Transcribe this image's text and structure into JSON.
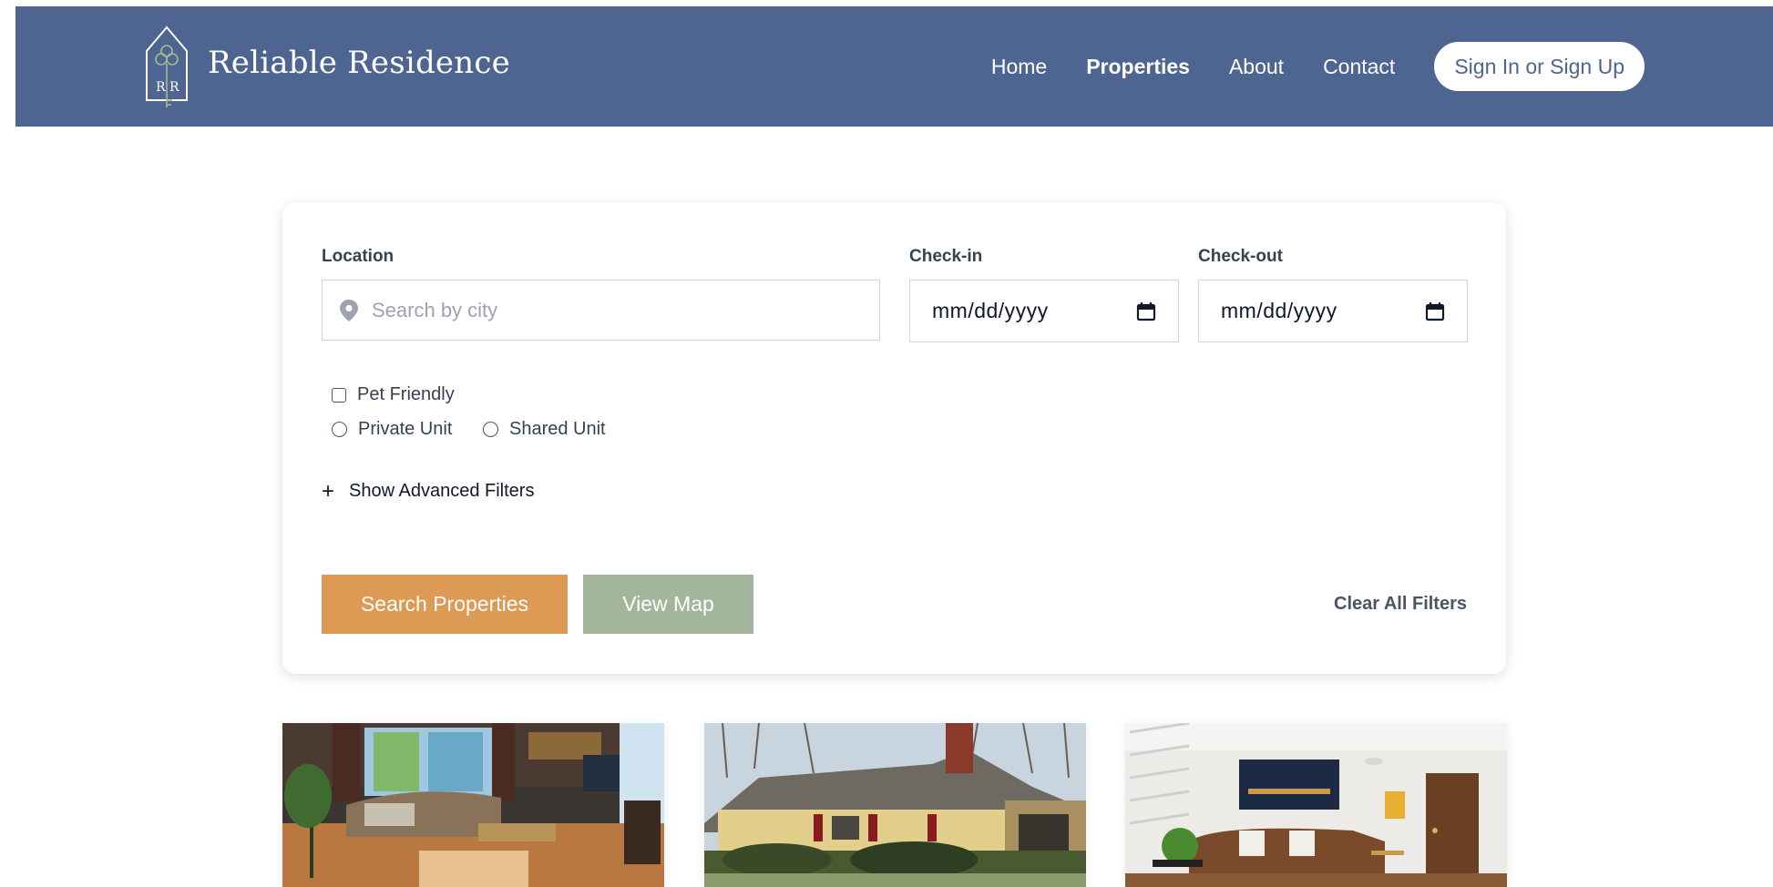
{
  "header": {
    "brand": "Reliable Residence",
    "logo_initials": "RR",
    "nav": [
      {
        "label": "Home",
        "active": false
      },
      {
        "label": "Properties",
        "active": true
      },
      {
        "label": "About",
        "active": false
      },
      {
        "label": "Contact",
        "active": false
      }
    ],
    "auth_button": "Sign In or Sign Up"
  },
  "search": {
    "location_label": "Location",
    "location_placeholder": "Search by city",
    "checkin_label": "Check-in",
    "checkin_value": "mm/dd/yyyy",
    "checkout_label": "Check-out",
    "checkout_value": "mm/dd/yyyy",
    "pet_friendly": "Pet Friendly",
    "private_unit": "Private Unit",
    "shared_unit": "Shared Unit",
    "advanced_filters": "Show Advanced Filters",
    "search_button": "Search Properties",
    "map_button": "View Map",
    "clear_filters": "Clear All Filters"
  },
  "icons": {
    "location": "map-pin-icon",
    "calendar": "calendar-icon",
    "plus": "plus-icon"
  },
  "colors": {
    "header_bg": "#4d6590",
    "search_button": "#dc9a55",
    "map_button": "#a3b59a",
    "logo_accent": "#a8b98e"
  },
  "properties": [
    {
      "image": "living-room-photo"
    },
    {
      "image": "house-exterior-photo"
    },
    {
      "image": "lounge-interior-photo"
    }
  ]
}
